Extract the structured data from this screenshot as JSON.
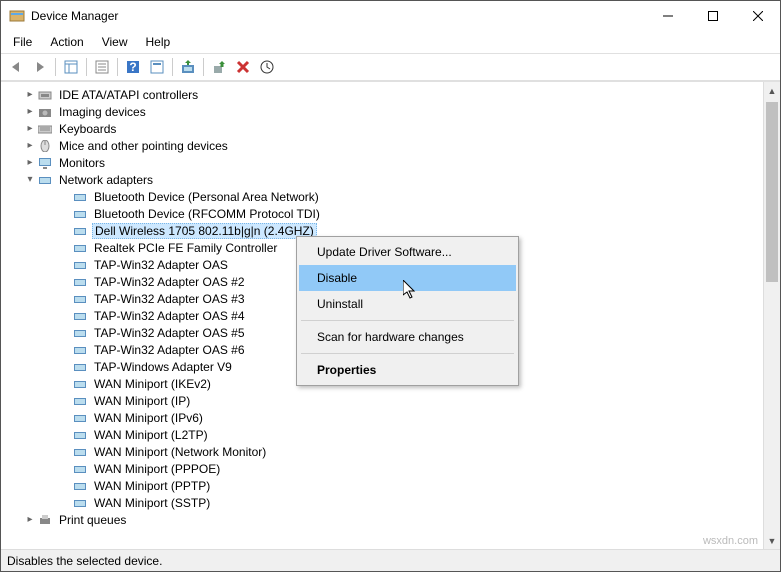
{
  "window": {
    "title": "Device Manager"
  },
  "menu": {
    "file": "File",
    "action": "Action",
    "view": "View",
    "help": "Help"
  },
  "tree": {
    "categories": [
      {
        "label": "IDE ATA/ATAPI controllers",
        "expanded": false,
        "icon": "ide"
      },
      {
        "label": "Imaging devices",
        "expanded": false,
        "icon": "imaging"
      },
      {
        "label": "Keyboards",
        "expanded": false,
        "icon": "keyboard"
      },
      {
        "label": "Mice and other pointing devices",
        "expanded": false,
        "icon": "mouse"
      },
      {
        "label": "Monitors",
        "expanded": false,
        "icon": "monitor"
      },
      {
        "label": "Network adapters",
        "expanded": true,
        "icon": "network",
        "children": [
          "Bluetooth Device (Personal Area Network)",
          "Bluetooth Device (RFCOMM Protocol TDI)",
          "Dell Wireless 1705 802.11b|g|n (2.4GHZ)",
          "Realtek PCIe FE Family Controller",
          "TAP-Win32 Adapter OAS",
          "TAP-Win32 Adapter OAS #2",
          "TAP-Win32 Adapter OAS #3",
          "TAP-Win32 Adapter OAS #4",
          "TAP-Win32 Adapter OAS #5",
          "TAP-Win32 Adapter OAS #6",
          "TAP-Windows Adapter V9",
          "WAN Miniport (IKEv2)",
          "WAN Miniport (IP)",
          "WAN Miniport (IPv6)",
          "WAN Miniport (L2TP)",
          "WAN Miniport (Network Monitor)",
          "WAN Miniport (PPPOE)",
          "WAN Miniport (PPTP)",
          "WAN Miniport (SSTP)"
        ],
        "selected_index": 2
      },
      {
        "label": "Print queues",
        "expanded": false,
        "icon": "printer"
      }
    ]
  },
  "context_menu": {
    "items": [
      {
        "label": "Update Driver Software...",
        "type": "item"
      },
      {
        "label": "Disable",
        "type": "item",
        "highlighted": true
      },
      {
        "label": "Uninstall",
        "type": "item"
      },
      {
        "type": "sep"
      },
      {
        "label": "Scan for hardware changes",
        "type": "item"
      },
      {
        "type": "sep"
      },
      {
        "label": "Properties",
        "type": "item",
        "bold": true
      }
    ]
  },
  "statusbar": {
    "text": "Disables the selected device."
  },
  "watermark": "wsxdn.com"
}
